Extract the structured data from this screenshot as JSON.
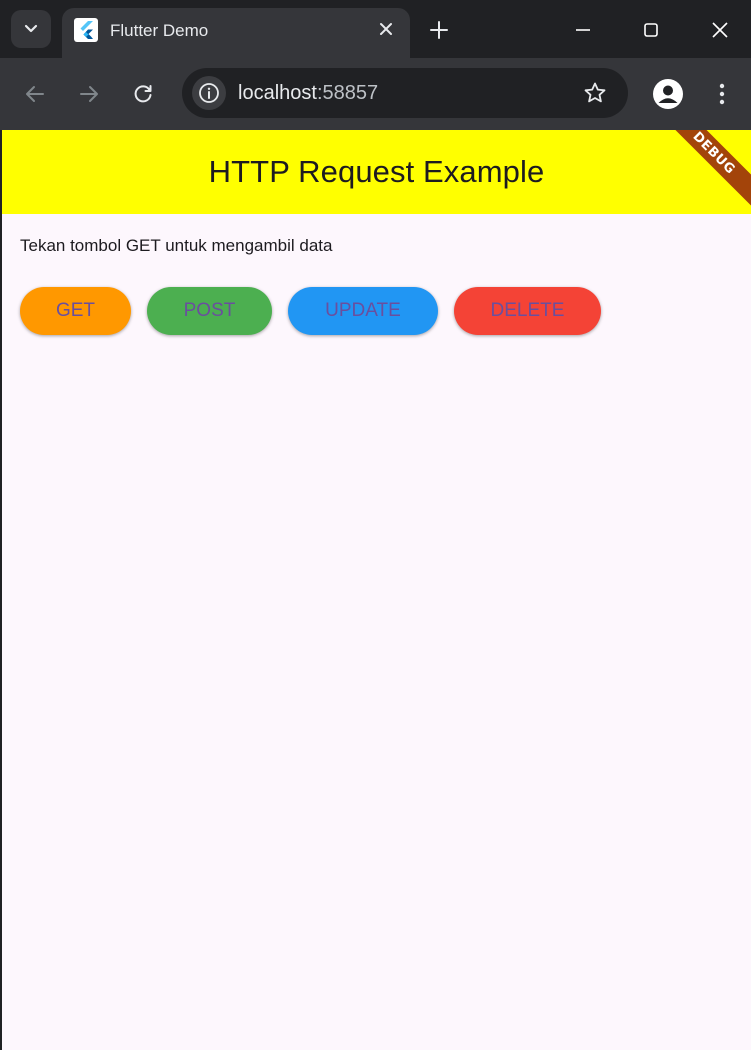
{
  "browser": {
    "tab": {
      "title": "Flutter Demo"
    },
    "omnibox": {
      "host": "localhost",
      "port": ":58857"
    }
  },
  "app": {
    "appbar_title": "HTTP Request Example",
    "debug_banner": "DEBUG",
    "appbar_color": "#ffff00",
    "status_text": "Tekan tombol GET untuk mengambil data",
    "buttons": [
      {
        "label": "GET",
        "color": "#ff9800"
      },
      {
        "label": "POST",
        "color": "#4caf50"
      },
      {
        "label": "UPDATE",
        "color": "#2196f3"
      },
      {
        "label": "DELETE",
        "color": "#f44336"
      }
    ]
  }
}
